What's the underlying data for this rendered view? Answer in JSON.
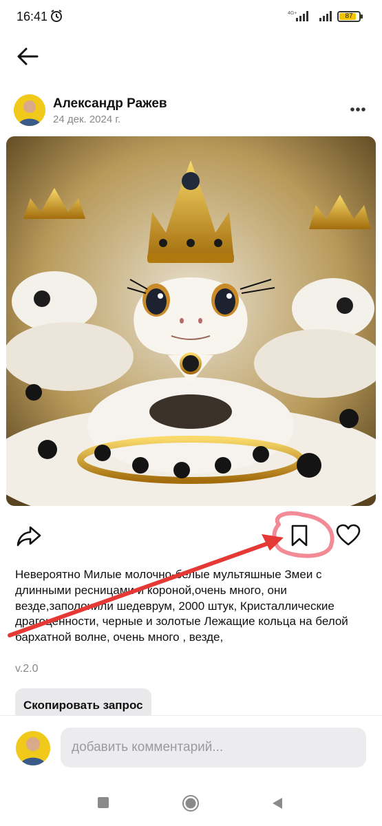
{
  "status_bar": {
    "time": "16:41",
    "network": "4G+",
    "battery": "87",
    "battery_level": 0.87,
    "alarm_icon": "alarm-clock-icon"
  },
  "post": {
    "author": "Александр Ражев",
    "date": "24 дек. 2024 г.",
    "image_alt": "Белые змеи с коронами и кристаллическими драгоценностями",
    "description": "Невероятно Милые молочно-белые мультяшные Змеи с длинными ресницами и короной,очень много, они везде,заполонили шедеврум, 2000 штук, Кристаллические драгоценности, черные и золотые Лежащие кольца на белой бархатной волне, очень много , везде,",
    "version": "v.2.0",
    "copy_button": "Скопировать запрос"
  },
  "comment": {
    "placeholder": "добавить комментарий..."
  },
  "icons": {
    "back": "arrow-left-icon",
    "more": "more-dots-icon",
    "share": "share-icon",
    "bookmark": "bookmark-icon",
    "like": "heart-icon"
  },
  "colors": {
    "annotation_red": "#e53935",
    "annotation_circle": "#f28b96",
    "battery": "#f3c400"
  }
}
